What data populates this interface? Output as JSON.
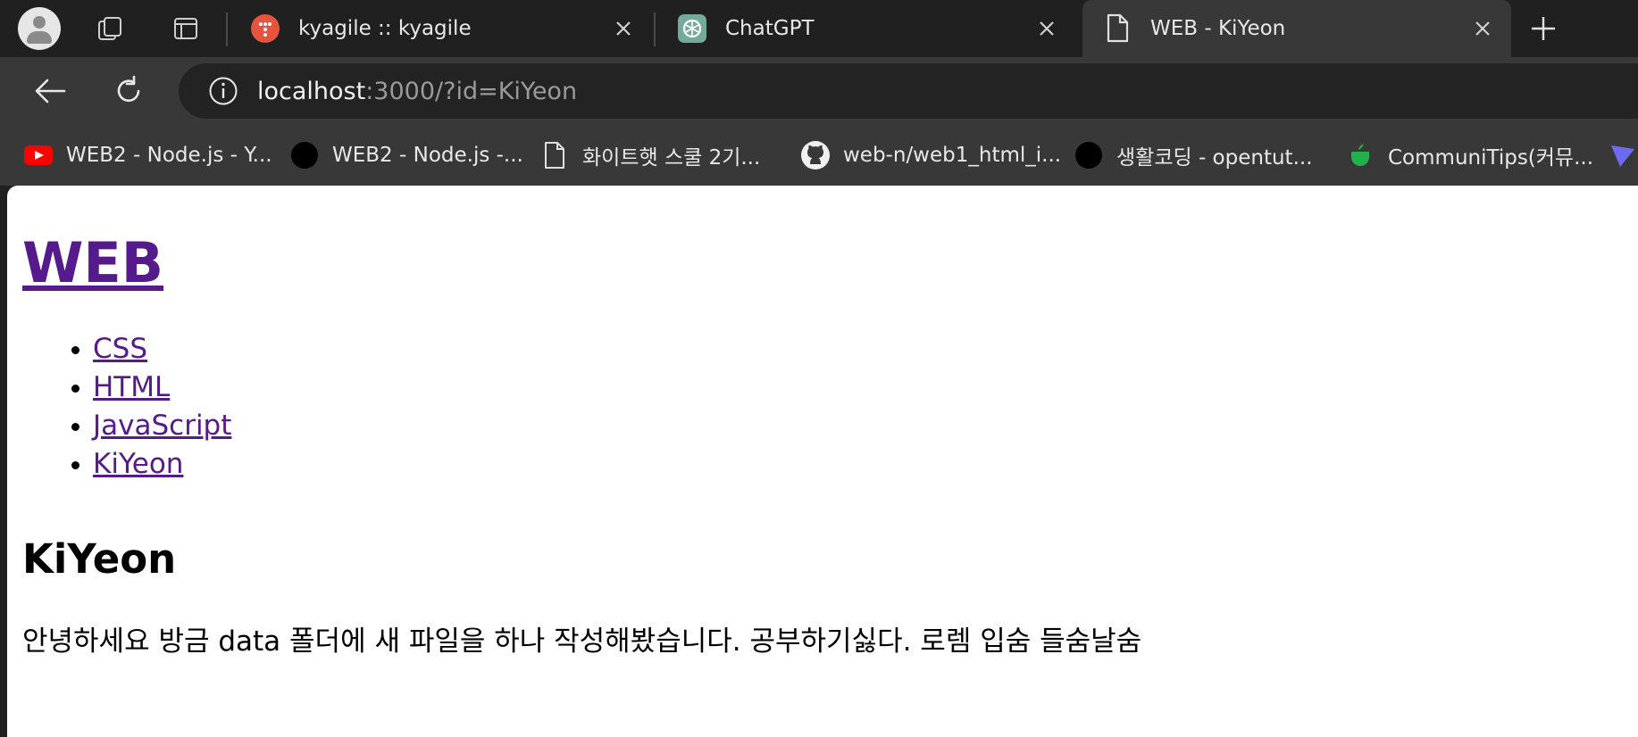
{
  "browser": {
    "tabs": [
      {
        "title": "kyagile :: kyagile",
        "favicon": "kyagile-icon",
        "active": false
      },
      {
        "title": "ChatGPT",
        "favicon": "chatgpt-icon",
        "active": false
      },
      {
        "title": "WEB - KiYeon",
        "favicon": "document-icon",
        "active": true
      }
    ],
    "address": {
      "host": "localhost",
      "rest": ":3000/?id=KiYeon"
    },
    "bookmarks": [
      {
        "label": "WEB2 - Node.js - Y...",
        "icon": "youtube-icon"
      },
      {
        "label": "WEB2 - Node.js -...",
        "icon": "black-circle-icon"
      },
      {
        "label": "화이트햇 스쿨 2기...",
        "icon": "document-icon"
      },
      {
        "label": "web-n/web1_html_i...",
        "icon": "github-icon"
      },
      {
        "label": "생활코딩 - opentut...",
        "icon": "black-circle-icon"
      },
      {
        "label": "CommuniTips(커뮤...",
        "icon": "green-cup-icon"
      }
    ]
  },
  "page": {
    "heading": "WEB",
    "nav": [
      "CSS",
      "HTML",
      "JavaScript",
      "KiYeon"
    ],
    "title": "KiYeon",
    "body": "안녕하세요 방금 data 폴더에 새 파일을 하나 작성해봤습니다. 공부하기싫다. 로렘 입숨 들숨날숨"
  },
  "colors": {
    "chrome_dark": "#202020",
    "toolbar": "#383838",
    "link_visited": "#551a8b"
  }
}
